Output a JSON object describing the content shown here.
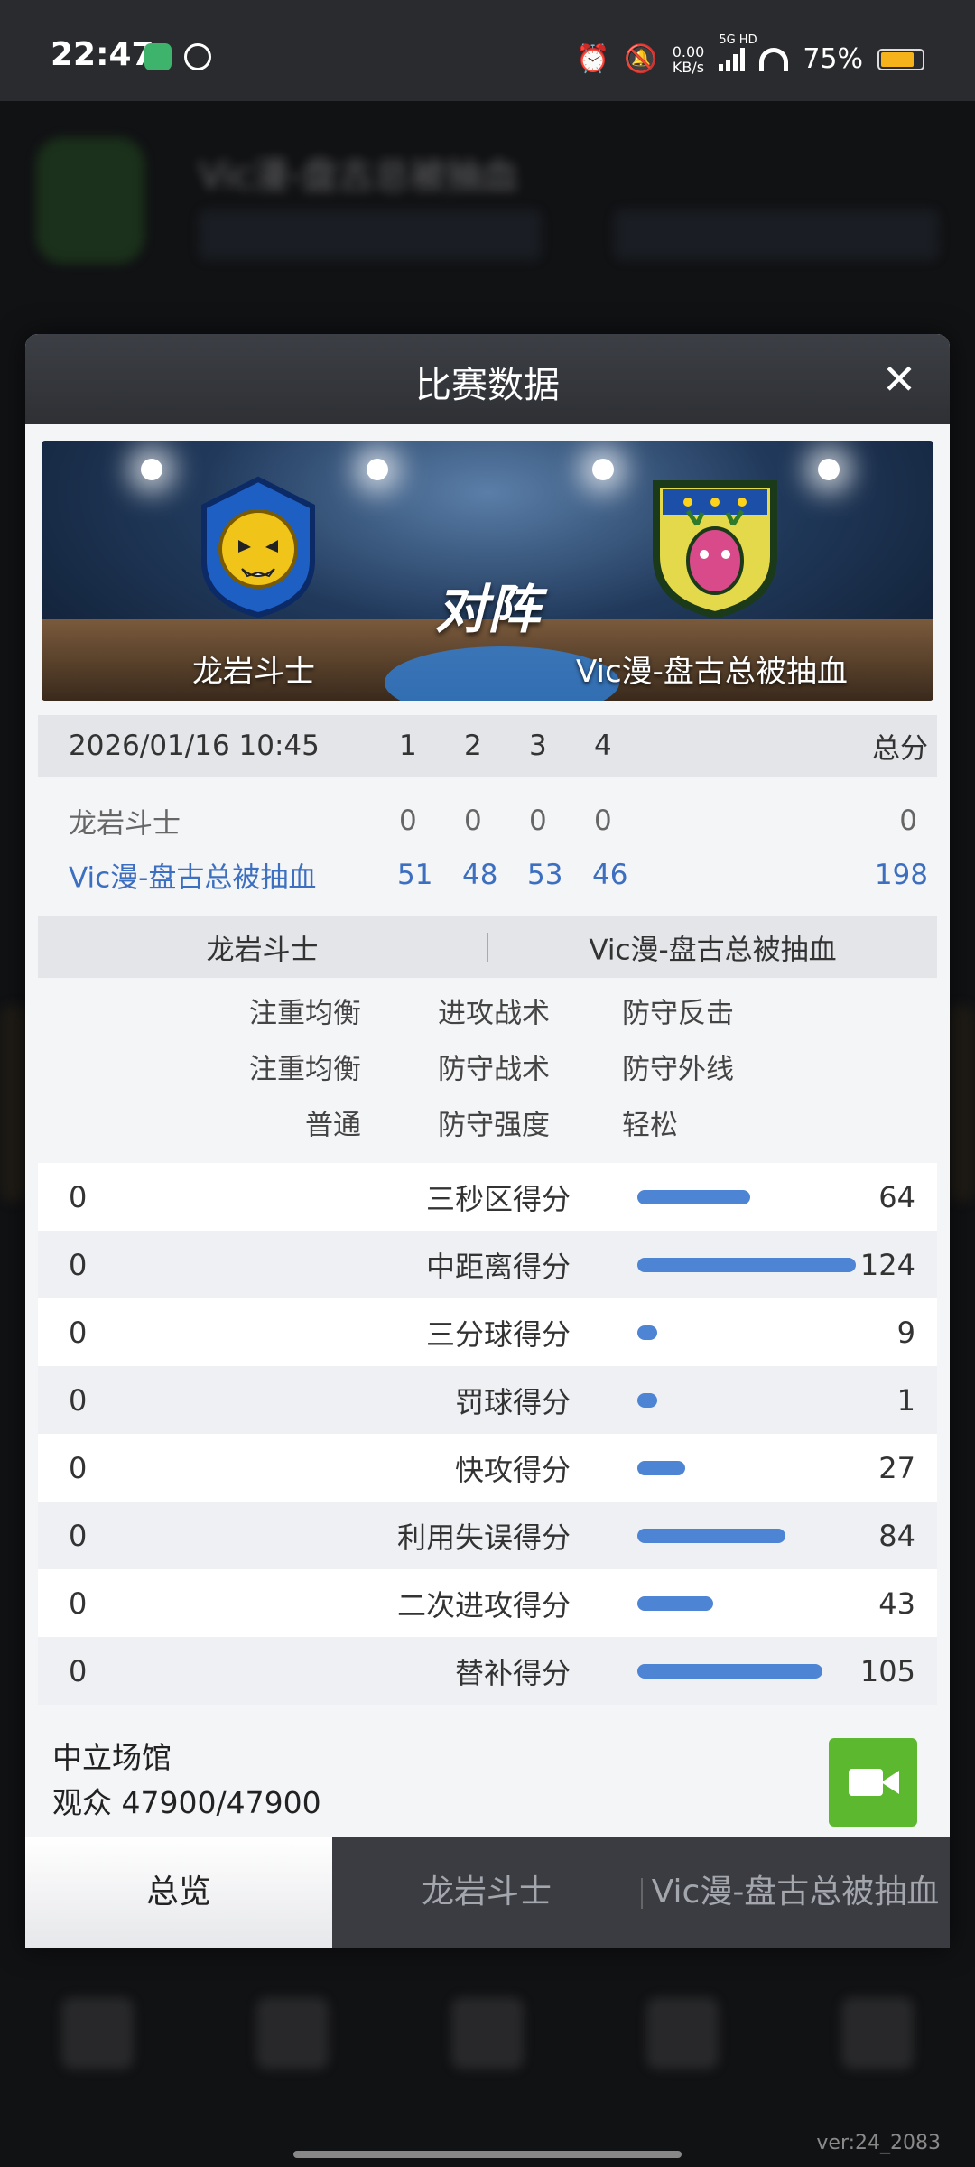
{
  "status_bar": {
    "time": "22:47",
    "net_speed_value": "0.00",
    "net_speed_unit": "KB/s",
    "network_type": "5G HD",
    "battery": "75%",
    "battery_level": 0.75,
    "icons": [
      "app-green-icon",
      "app-circle-icon",
      "alarm-icon",
      "mute-icon",
      "signal-icon",
      "wifi-icon",
      "battery-icon"
    ]
  },
  "background": {
    "team_title": "Vic漫-盘古总被抽血",
    "version": "ver:24_2083"
  },
  "modal": {
    "title": "比赛数据",
    "close_icon": "close-icon"
  },
  "banner": {
    "vs_text": "对阵",
    "home_team": "龙岩斗士",
    "away_team": "Vic漫-盘古总被抽血"
  },
  "scoreboard": {
    "datetime": "2026/01/16 10:45",
    "quarters": [
      "1",
      "2",
      "3",
      "4"
    ],
    "total_label": "总分",
    "rows": [
      {
        "team": "龙岩斗士",
        "q": [
          "0",
          "0",
          "0",
          "0"
        ],
        "total": "0"
      },
      {
        "team": "Vic漫-盘古总被抽血",
        "q": [
          "51",
          "48",
          "53",
          "46"
        ],
        "total": "198"
      }
    ]
  },
  "team_header": {
    "left": "龙岩斗士",
    "right": "Vic漫-盘古总被抽血"
  },
  "tactics": [
    {
      "left": "注重均衡",
      "middle": "进攻战术",
      "right": "防守反击"
    },
    {
      "left": "注重均衡",
      "middle": "防守战术",
      "right": "防守外线"
    },
    {
      "left": "普通",
      "middle": "防守强度",
      "right": "轻松"
    }
  ],
  "stats": [
    {
      "left": "0",
      "label": "三秒区得分",
      "right": "64",
      "right_value": 64
    },
    {
      "left": "0",
      "label": "中距离得分",
      "right": "124",
      "right_value": 124
    },
    {
      "left": "0",
      "label": "三分球得分",
      "right": "9",
      "right_value": 9
    },
    {
      "left": "0",
      "label": "罚球得分",
      "right": "1",
      "right_value": 1
    },
    {
      "left": "0",
      "label": "快攻得分",
      "right": "27",
      "right_value": 27
    },
    {
      "left": "0",
      "label": "利用失误得分",
      "right": "84",
      "right_value": 84
    },
    {
      "left": "0",
      "label": "二次进攻得分",
      "right": "43",
      "right_value": 43
    },
    {
      "left": "0",
      "label": "替补得分",
      "right": "105",
      "right_value": 105
    }
  ],
  "stats_bar_max": 124,
  "venue": {
    "name": "中立场馆",
    "attendance": "观众 47900/47900"
  },
  "video_button_icon": "video-camera-icon",
  "tabs": [
    {
      "label": "总览",
      "active": true
    },
    {
      "label": "龙岩斗士",
      "active": false
    },
    {
      "label": "Vic漫-盘古总被抽血",
      "active": false
    }
  ],
  "colors": {
    "accent_blue": "#3d6fc0",
    "bar_blue": "#4d84d4",
    "video_green": "#5cb82e",
    "header_dark": "#2e3034"
  }
}
